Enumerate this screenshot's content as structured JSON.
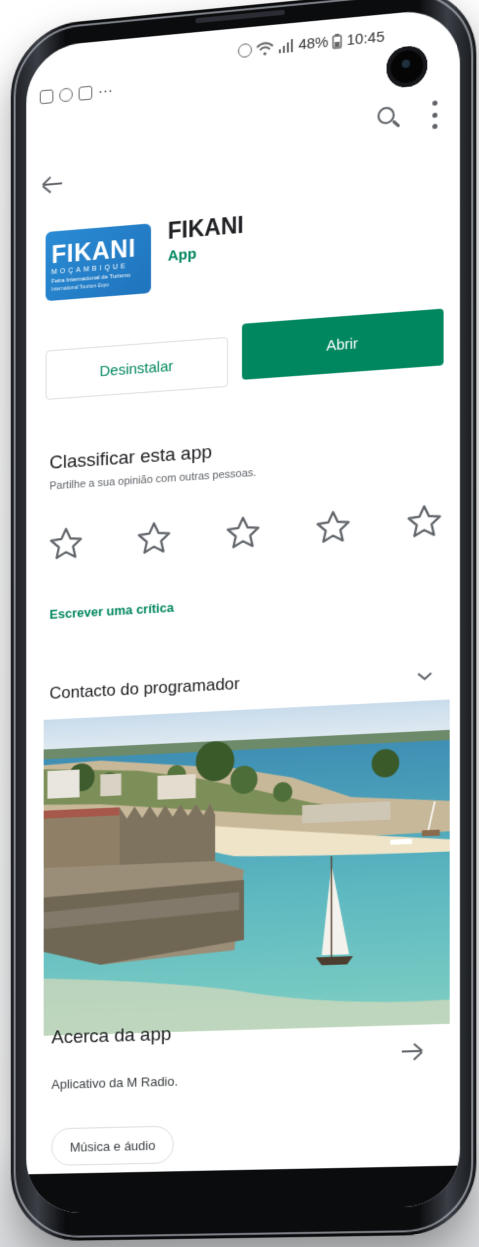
{
  "status_bar": {
    "left_icons": [
      "image-icon",
      "dollar-icon",
      "mail-icon"
    ],
    "left_more": "···",
    "battery_percent": "48%",
    "time": "10:45",
    "right_icons": [
      "alarm-icon",
      "wifi-icon",
      "signal-icon",
      "battery-icon"
    ]
  },
  "toolbar": {
    "search_icon": "search-icon",
    "more_icon": "more-vert-icon",
    "back_icon": "arrow-back-icon"
  },
  "app": {
    "icon_text": {
      "brand": "FIKANI",
      "line1": "MOÇAMBIQUE",
      "line2": "Feira Internacional de Turismo",
      "line3": "International Tourism Expo"
    },
    "title": "FIKANI",
    "category": "App"
  },
  "actions": {
    "uninstall_label": "Desinstalar",
    "open_label": "Abrir"
  },
  "rating": {
    "title": "Classificar esta app",
    "subtitle": "Partilhe a sua opinião com outras pessoas.",
    "star_count": 5,
    "write_review_label": "Escrever uma crítica"
  },
  "contact": {
    "title": "Contacto do programador",
    "chevron_icon": "chevron-down-icon"
  },
  "about": {
    "title": "Acerca da app",
    "arrow_icon": "arrow-forward-icon",
    "description": "Aplicativo da M Radio.",
    "chip_label": "Música e áudio"
  },
  "colors": {
    "accent_green": "#01875f",
    "text_primary": "#202124",
    "text_secondary": "#5f6368",
    "icon_blue": "#2a8bd4"
  }
}
